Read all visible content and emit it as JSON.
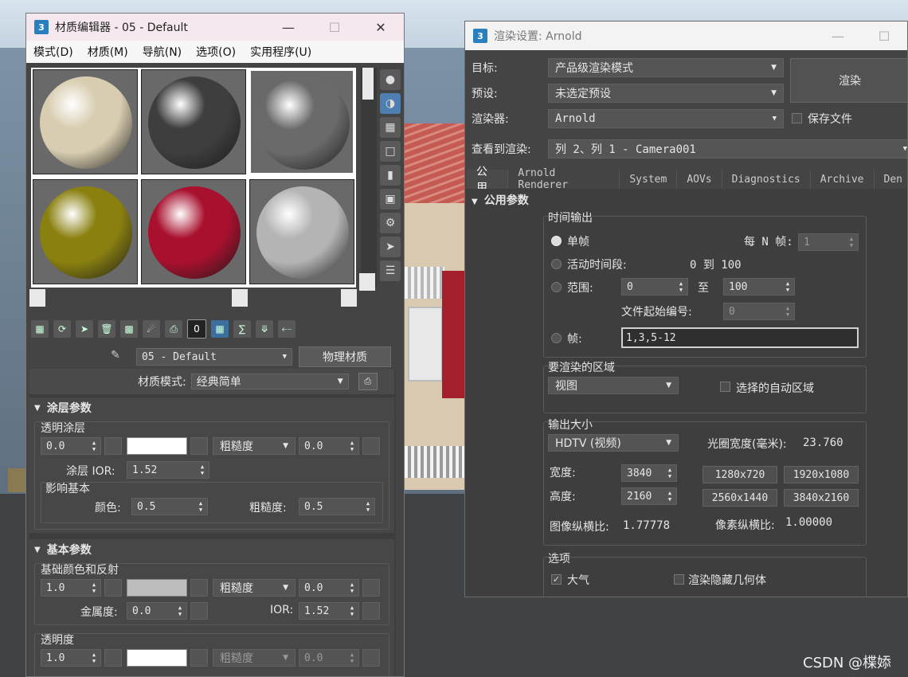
{
  "material_editor": {
    "title": "材质编辑器 - 05 - Default",
    "app_icon": "3",
    "menu": [
      "模式(D)",
      "材质(M)",
      "导航(N)",
      "选项(O)",
      "实用程序(U)"
    ],
    "sample_slots": [
      {
        "color": "#d8cdb0"
      },
      {
        "color": "#3e3e3e"
      },
      {
        "color": "#6a6a6a"
      },
      {
        "color": "#8a8010"
      },
      {
        "color": "#a8102e"
      },
      {
        "color": "#b4b4b4"
      }
    ],
    "side_tools": [
      "sphere-icon",
      "backlight-icon",
      "checker-background-icon",
      "uv-tiling-icon",
      "video-color-check-icon",
      "make-preview-icon",
      "options-icon",
      "select-by-material-icon",
      "material-map-navigator-icon"
    ],
    "bottom_toolbar": [
      "get-material-icon",
      "put-to-scene-icon",
      "assign-to-selection-icon",
      "delete-icon",
      "make-unique-icon",
      "put-to-library-icon",
      "save-icon",
      "material-id-channel-icon",
      "show-shaded-icon",
      "show-end-result-icon",
      "go-to-parent-icon",
      "go-forward-icon"
    ],
    "material_id": "0",
    "material_name": "05 - Default",
    "material_type": "物理材质",
    "material_mode_label": "材质模式:",
    "material_mode_value": "经典简单",
    "coating": {
      "title": "涂层参数",
      "clearcoat_group": "透明涂层",
      "weight": "0.0",
      "color": "#ffffff",
      "roughness_label": "粗糙度",
      "roughness": "0.0",
      "ior_label": "涂层 IOR:",
      "ior": "1.52",
      "affect_group": "影响基本",
      "color_label": "颜色:",
      "affect_color": "0.5",
      "affect_rough_label": "粗糙度:",
      "affect_roughness": "0.5"
    },
    "basic": {
      "title": "基本参数",
      "base_group": "基础颜色和反射",
      "weight": "1.0",
      "color": "#bdbdbd",
      "roughness_label": "粗糙度",
      "roughness": "0.0",
      "metal_label": "金属度:",
      "metalness": "0.0",
      "ior_label": "IOR:",
      "ior": "1.52",
      "transparency_group": "透明度",
      "trans_weight": "1.0",
      "trans_color": "#ffffff",
      "trans_rough_label": "粗糙度",
      "trans_roughness": "0.0"
    }
  },
  "render_settings": {
    "title": "渲染设置: Arnold",
    "app_icon": "3",
    "target_label": "目标:",
    "target_value": "产品级渲染模式",
    "preset_label": "预设:",
    "preset_value": "未选定预设",
    "renderer_label": "渲染器:",
    "renderer_value": "Arnold",
    "save_file_label": "保存文件",
    "view_label": "查看到渲染:",
    "view_value": "列 2、列 1 - Camera001",
    "render_button": "渲染",
    "tabs": [
      "公用",
      "Arnold Renderer",
      "System",
      "AOVs",
      "Diagnostics",
      "Archive",
      "Den"
    ],
    "common_rollout": "公用参数",
    "time_output": {
      "group": "时间输出",
      "single_label": "单帧",
      "every_n_label": "每 N 帧:",
      "every_n": "1",
      "active_label": "活动时间段:",
      "active_range": "0 到 100",
      "range_label": "范围:",
      "range_start": "0",
      "to_label": "至",
      "range_end": "100",
      "file_num_label": "文件起始编号:",
      "file_num": "0",
      "frames_label": "帧:",
      "frames_value": "1,3,5-12"
    },
    "area": {
      "group": "要渲染的区域",
      "area_value": "视图",
      "auto_region_label": "选择的自动区域"
    },
    "output_size": {
      "group": "输出大小",
      "preset": "HDTV (视频)",
      "aperture_label": "光圈宽度(毫米):",
      "aperture": "23.760",
      "width_label": "宽度:",
      "width": "3840",
      "height_label": "高度:",
      "height": "2160",
      "presets": [
        "1280x720",
        "1920x1080",
        "2560x1440",
        "3840x2160"
      ],
      "image_aspect_label": "图像纵横比:",
      "image_aspect": "1.77778",
      "pixel_aspect_label": "像素纵横比:",
      "pixel_aspect": "1.00000"
    },
    "options": {
      "group": "选项",
      "atmosphere_label": "大气",
      "render_hidden_label": "渲染隐藏几何体"
    }
  },
  "watermark": "CSDN @楪婖"
}
